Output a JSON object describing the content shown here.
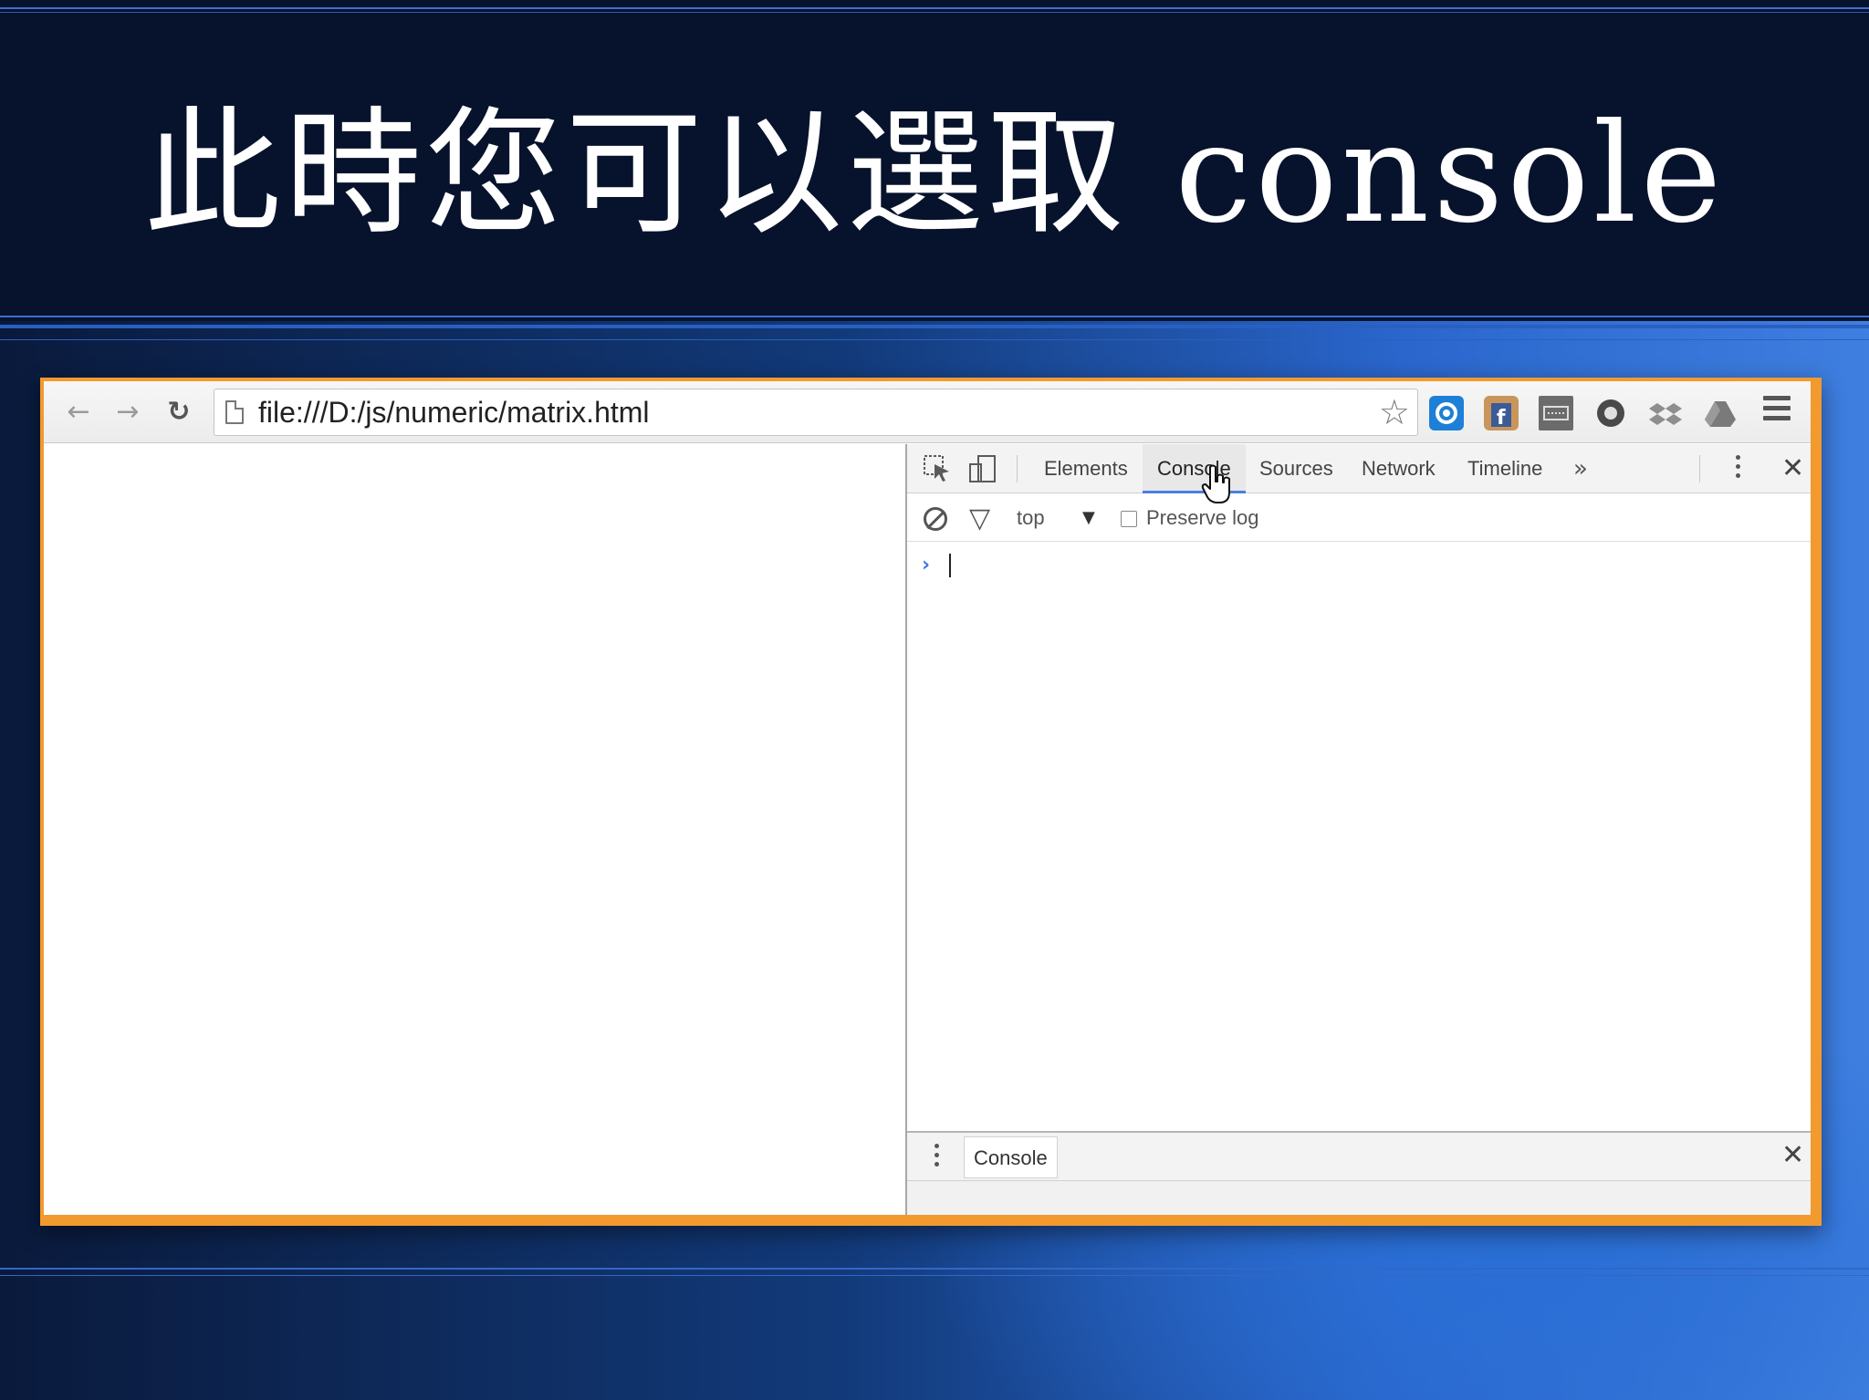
{
  "slide": {
    "title": "此時您可以選取 console"
  },
  "browser": {
    "url": "file:///D:/js/numeric/matrix.html",
    "back_icon": "arrow-left-icon",
    "forward_icon": "arrow-right-icon",
    "reload_icon": "reload-icon",
    "bookmark_icon": "star-icon",
    "extensions": [
      "extension-1-icon",
      "facebook-icon",
      "keyboard-icon",
      "extension-4-icon",
      "dropbox-icon",
      "drive-icon"
    ],
    "menu_icon": "hamburger-menu-icon"
  },
  "devtools": {
    "tabs": [
      {
        "label": "Elements",
        "active": false
      },
      {
        "label": "Console",
        "active": true
      },
      {
        "label": "Sources",
        "active": false
      },
      {
        "label": "Network",
        "active": false
      },
      {
        "label": "Timeline",
        "active": false
      }
    ],
    "more_tabs": "»",
    "filter": {
      "context": "top",
      "preserve_log_label": "Preserve log",
      "preserve_log_checked": false
    },
    "prompt": "›",
    "drawer": {
      "tab_label": "Console"
    }
  },
  "colors": {
    "title_band": "#07132c",
    "window_frame": "#f29a2e",
    "active_tab_underline": "#4a7fe0",
    "prompt": "#3b78e7"
  }
}
